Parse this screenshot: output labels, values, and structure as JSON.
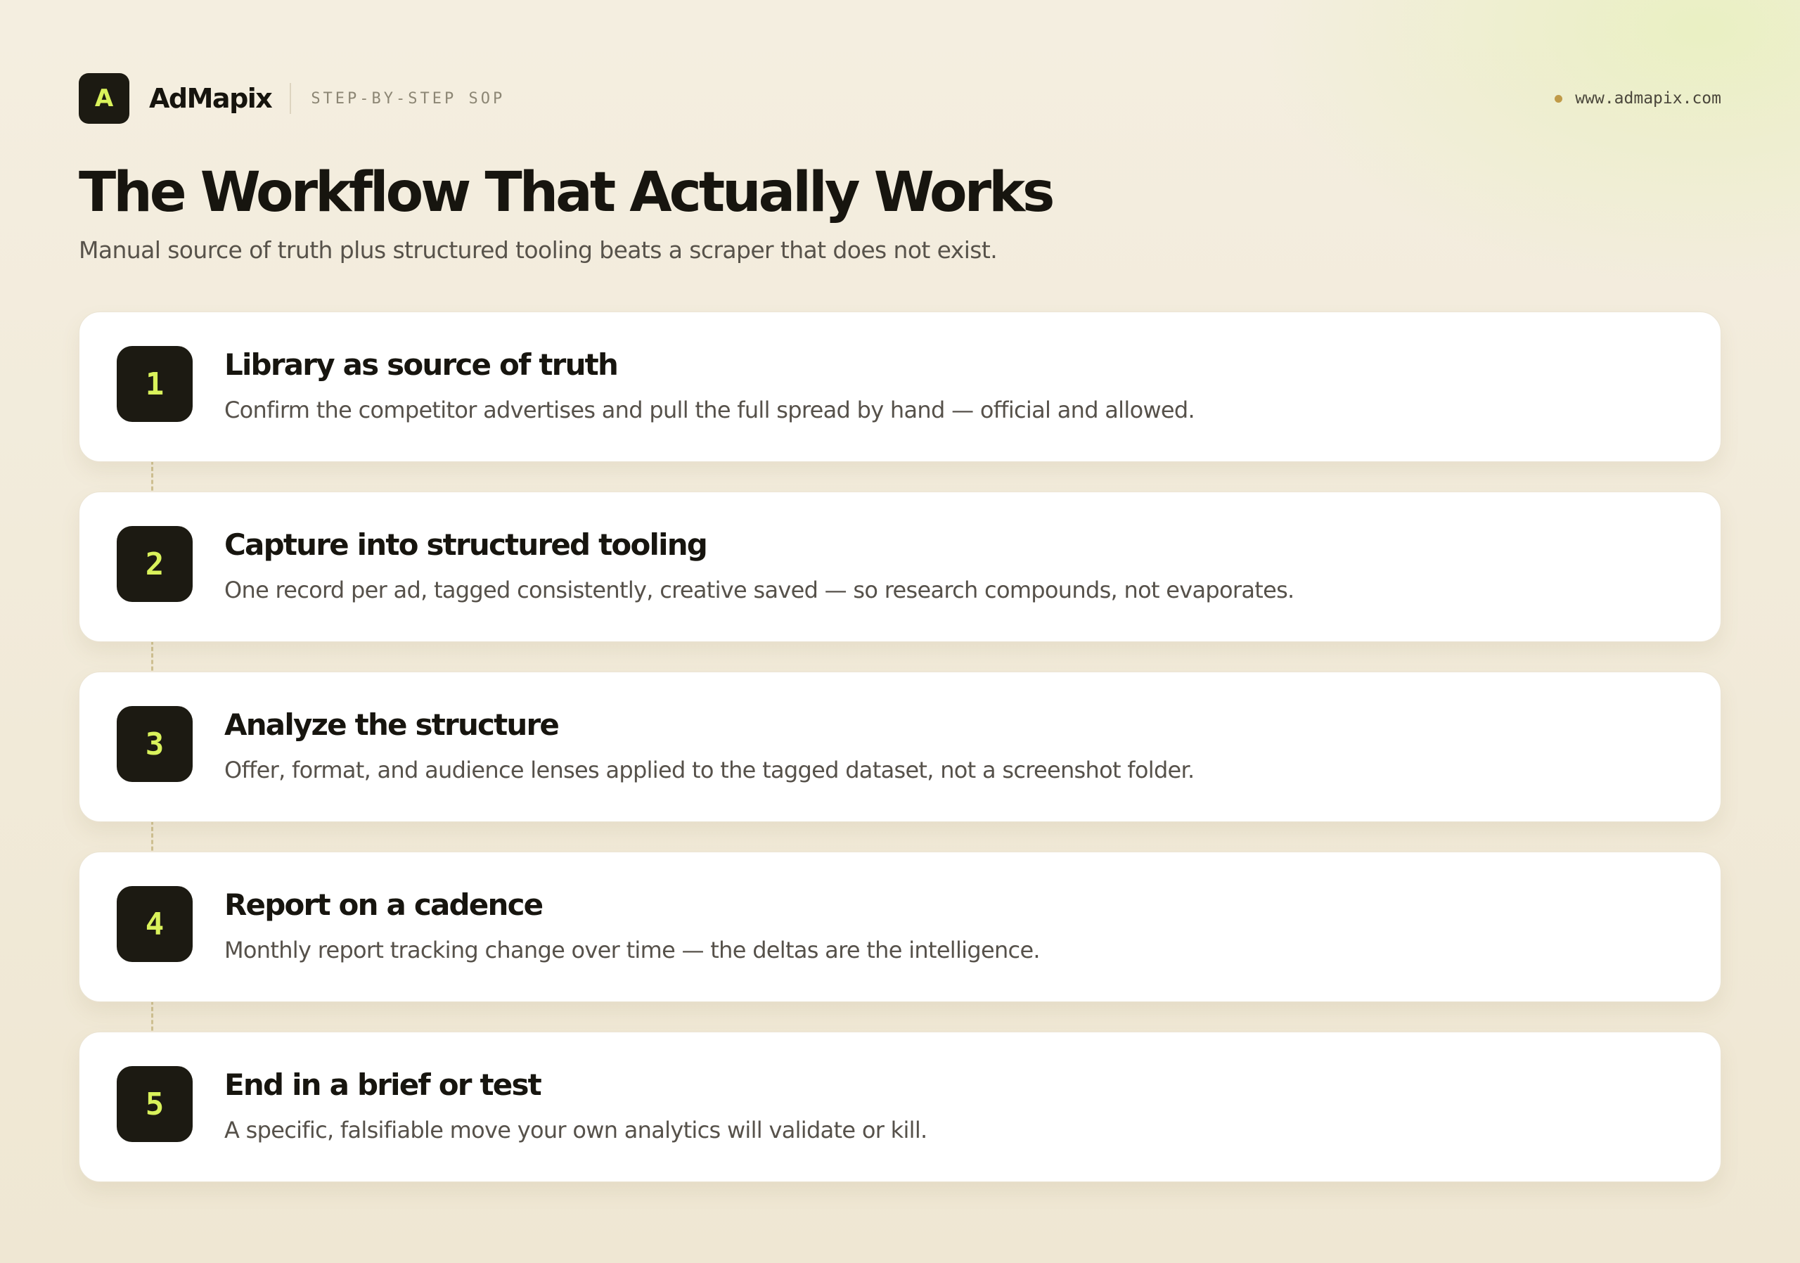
{
  "brand": {
    "logo_letter": "A",
    "name": "AdMapix",
    "tag": "STEP-BY-STEP SOP",
    "website": "www.admapix.com"
  },
  "header": {
    "title": "The Workflow That Actually Works",
    "subtitle": "Manual source of truth plus structured tooling beats a scraper that does not exist."
  },
  "steps": [
    {
      "number": "1",
      "title": "Library as source of truth",
      "description": "Confirm the competitor advertises and pull the full spread by hand — official and allowed."
    },
    {
      "number": "2",
      "title": "Capture into structured tooling",
      "description": "One record per ad, tagged consistently, creative saved — so research compounds, not evaporates."
    },
    {
      "number": "3",
      "title": "Analyze the structure",
      "description": "Offer, format, and audience lenses applied to the tagged dataset, not a screenshot folder."
    },
    {
      "number": "4",
      "title": "Report on a cadence",
      "description": "Monthly report tracking change over time — the deltas are the intelligence."
    },
    {
      "number": "5",
      "title": "End in a brief or test",
      "description": "A specific, falsifiable move your own analytics will validate or kill."
    }
  ],
  "colors": {
    "accent": "#d9f25b",
    "badge_background": "#1c1a12",
    "dot": "#c09a48",
    "connector": "#cfc193"
  }
}
